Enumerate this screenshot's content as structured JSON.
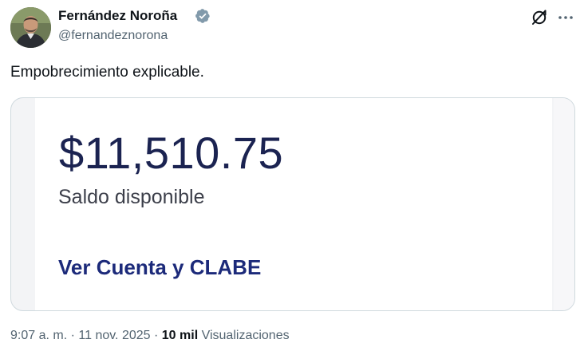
{
  "author": {
    "name": "Fernández Noroña",
    "handle": "@fernandeznorona",
    "verified_icon": "verified-badge-icon"
  },
  "header_actions": {
    "grok_icon": "grok-icon",
    "more_icon": "more-horizontal-icon"
  },
  "tweet": {
    "text": "Empobrecimiento explicable."
  },
  "media": {
    "balance_amount": "$11,510.75",
    "balance_label": "Saldo disponible",
    "account_link": "Ver Cuenta y CLABE"
  },
  "meta": {
    "time": "9:07 a. m.",
    "separator": "·",
    "date": "11 nov. 2025",
    "views_count": "10 mil",
    "views_label": "Visualizaciones"
  },
  "colors": {
    "text_primary": "#0f1419",
    "text_secondary": "#536471",
    "verified_badge": "#829aab",
    "balance_navy": "#1b2351",
    "link_navy": "#1c2a7a",
    "card_border": "#cfd9de"
  }
}
